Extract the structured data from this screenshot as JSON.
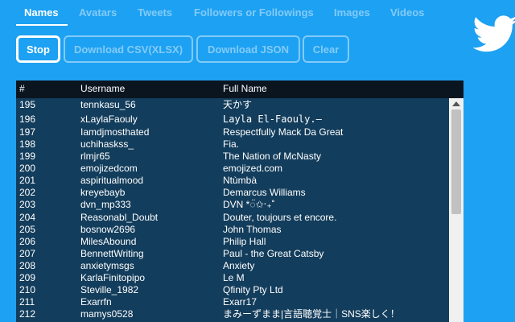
{
  "tabs": [
    {
      "label": "Names",
      "active": true
    },
    {
      "label": "Avatars",
      "active": false
    },
    {
      "label": "Tweets",
      "active": false
    },
    {
      "label": "Followers or Followings",
      "active": false
    },
    {
      "label": "Images",
      "active": false
    },
    {
      "label": "Videos",
      "active": false
    }
  ],
  "buttons": {
    "stop": "Stop",
    "download_csv": "Download CSV(XLSX)",
    "download_json": "Download JSON",
    "clear": "Clear"
  },
  "table": {
    "headers": {
      "num": "#",
      "username": "Username",
      "fullname": "Full Name"
    },
    "rows": [
      {
        "num": "195",
        "username": "tennkasu_56",
        "fullname": "天かす"
      },
      {
        "num": "196",
        "username": "xLaylaFaouly",
        "fullname": "Layla El-Faouly.—"
      },
      {
        "num": "197",
        "username": "Iamdjmosthated",
        "fullname": "Respectfully Mack Da Great"
      },
      {
        "num": "198",
        "username": "uchihaskss_",
        "fullname": "Fia."
      },
      {
        "num": "199",
        "username": "rlmjr65",
        "fullname": "The Nation of McNasty"
      },
      {
        "num": "200",
        "username": "emojizedcom",
        "fullname": "emojized.com"
      },
      {
        "num": "201",
        "username": "aspiritualmood",
        "fullname": "Ntùmbà"
      },
      {
        "num": "202",
        "username": "kreyebayb",
        "fullname": "Demarcus Williams"
      },
      {
        "num": "203",
        "username": "dvn_mp333",
        "fullname": "DVN *◌̈✩‧₊˚"
      },
      {
        "num": "204",
        "username": "Reasonabl_Doubt",
        "fullname": "Douter, toujours et encore."
      },
      {
        "num": "205",
        "username": "bosnow2696",
        "fullname": "John Thomas"
      },
      {
        "num": "206",
        "username": "MilesAbound",
        "fullname": "Philip Hall"
      },
      {
        "num": "207",
        "username": "BennettWriting",
        "fullname": "Paul - the Great Catsby"
      },
      {
        "num": "208",
        "username": "anxietymsgs",
        "fullname": "Anxiety"
      },
      {
        "num": "209",
        "username": "KarlaFinitopipo",
        "fullname": "Le M"
      },
      {
        "num": "210",
        "username": "Steville_1982",
        "fullname": "Qfinity Pty Ltd"
      },
      {
        "num": "211",
        "username": "Exarrfn",
        "fullname": "Exarr17"
      },
      {
        "num": "212",
        "username": "mamys0528",
        "fullname": "まみーずまま|言語聴覚士｜SNS楽しく！"
      }
    ]
  },
  "icons": {
    "logo": "twitter-bird-icon",
    "scroll_up": "scroll-up-arrow-icon"
  }
}
